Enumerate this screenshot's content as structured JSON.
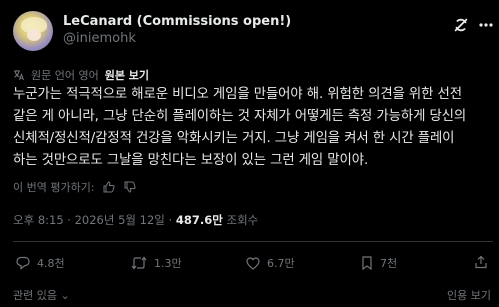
{
  "author": {
    "name": "LeCanard (Commissions open!)",
    "handle": "@iniemohk"
  },
  "translation": {
    "info": "원문 언어 영어",
    "show_original": "원본 보기"
  },
  "post": {
    "lines": [
      "누군가는 적극적으로 해로운 비디오 게임을 만들어야 해. 위험한 의견을 위한 선전",
      "같은 게 아니라, 그냥 단순히 플레이하는 것 자체가 어떻게든 측정 가능하게 당신의",
      "신체적/정신적/감정적 건강을 악화시키는 거지. 그냥 게임을 켜서 한 시간 플레이",
      "하는 것만으로도 그날을 망친다는 보장이 있는 그런 게임 말이야."
    ]
  },
  "rate": {
    "label": "이 번역 평가하기:"
  },
  "meta": {
    "time": "오후 8:15",
    "date": "2026년 5월 12일",
    "views_count": "487.6만",
    "views_label": "조회수",
    "separator": "·"
  },
  "actions": {
    "replies": "4.8천",
    "reposts": "1.3만",
    "likes": "6.7만",
    "bookmarks": "7천"
  },
  "footer": {
    "left": "관련 있음 ⌄",
    "right": "인용 보기"
  }
}
